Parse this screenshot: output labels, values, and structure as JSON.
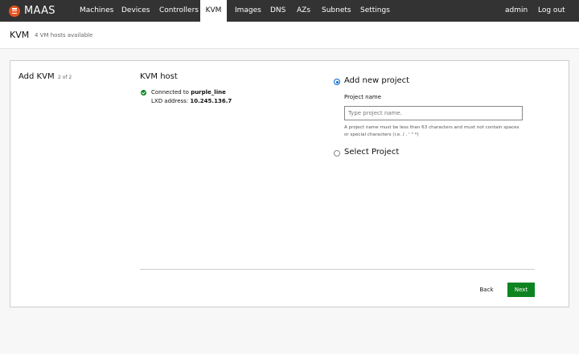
{
  "navbar": {
    "logo_text": "MAAS",
    "items": [
      {
        "label": "Machines"
      },
      {
        "label": "Devices"
      },
      {
        "label": "Controllers"
      },
      {
        "label": "KVM"
      },
      {
        "label": "Images"
      },
      {
        "label": "DNS"
      },
      {
        "label": "AZs"
      },
      {
        "label": "Subnets"
      },
      {
        "label": "Settings"
      }
    ],
    "active_item": "KVM",
    "user": "admin",
    "logout": "Log out"
  },
  "header": {
    "title": "KVM",
    "subtitle": "4 VM hosts available"
  },
  "card": {
    "title": "Add KVM",
    "step": "2 of 2",
    "host": {
      "title": "KVM host",
      "connected_prefix": "Connected to",
      "connected_name": "purple_line",
      "address_label": "LXD address:",
      "address_value": "10.245.136.7"
    },
    "options": {
      "new_project_label": "Add new project",
      "project_name_label": "Project name",
      "project_name_value": "",
      "project_name_placeholder": "Type project name.",
      "help_text": "A project name must be less than 63 characters and must not contain spaces or special characters (i.e. / . ' \" *)",
      "select_project_label": "Select Project",
      "selected": "new_project"
    },
    "actions": {
      "back": "Back",
      "next": "Next"
    }
  },
  "colors": {
    "navbar_bg": "#333333",
    "brand": "#e95420",
    "positive": "#0e8420",
    "radio_selected": "#0066cc"
  }
}
